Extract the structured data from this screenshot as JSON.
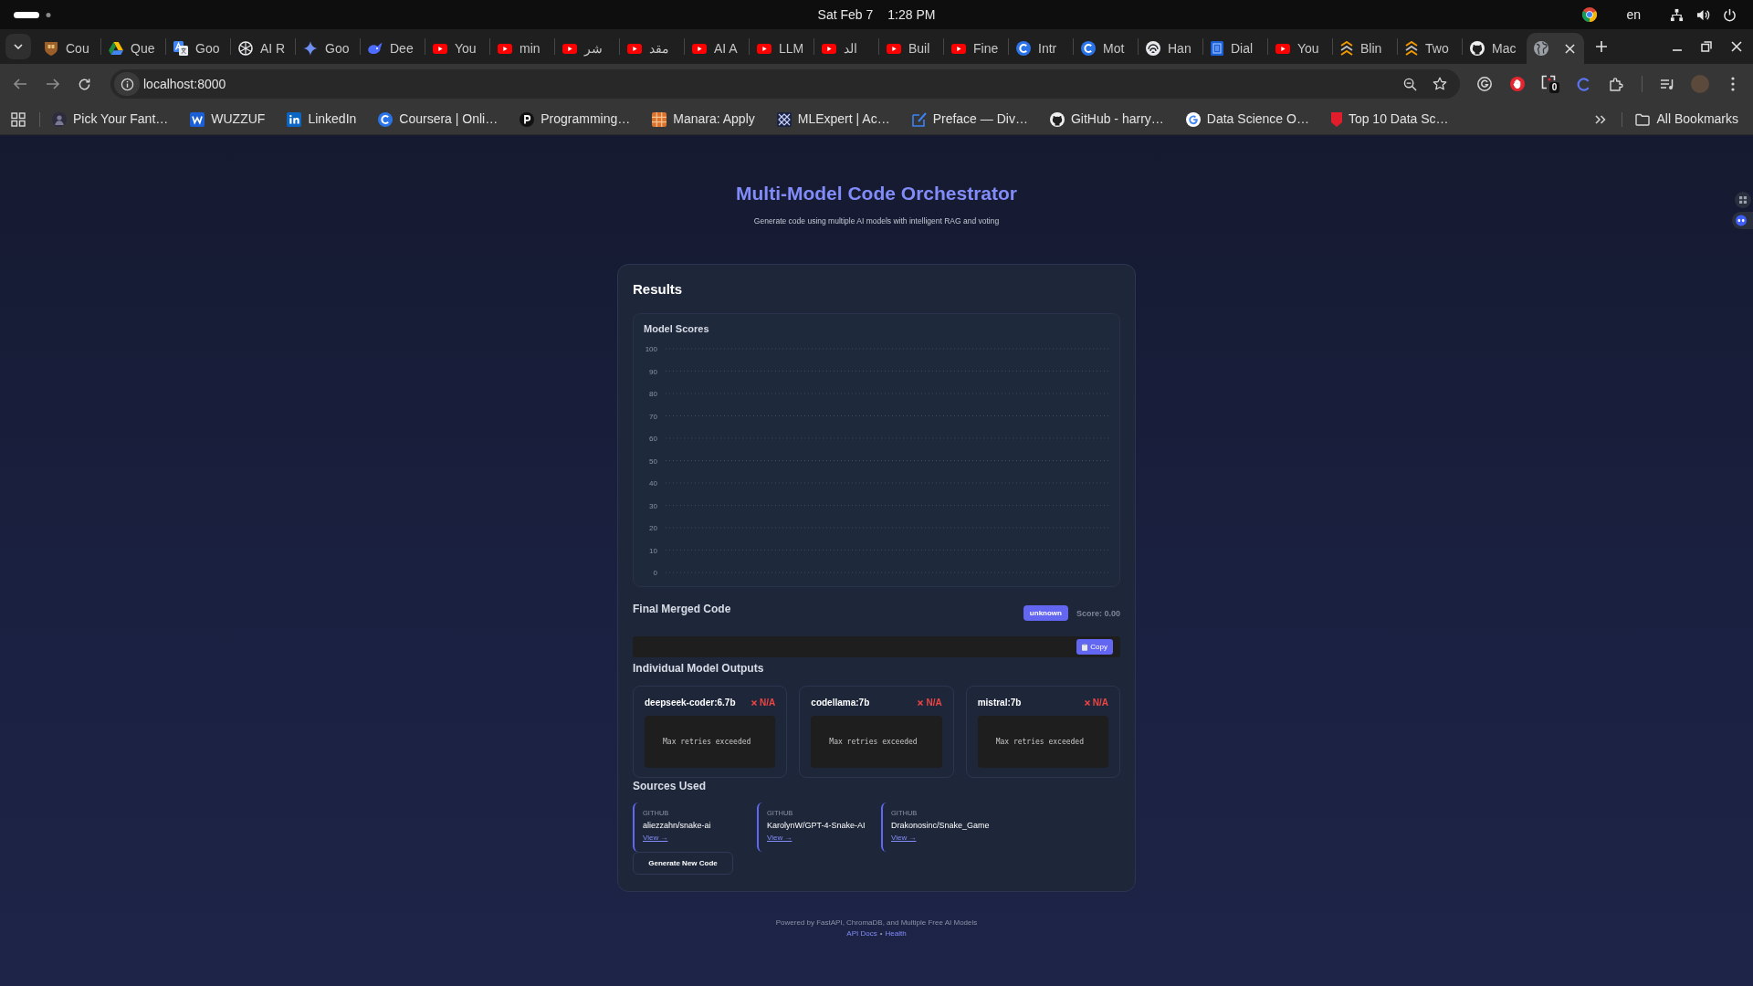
{
  "system_bar": {
    "date": "Sat Feb 7",
    "time": "1:28 PM",
    "input_language": "en"
  },
  "browser": {
    "tabs": [
      {
        "kind": "crest",
        "title": "Cou",
        "selected": false
      },
      {
        "kind": "triangle",
        "title": "Que",
        "selected": false
      },
      {
        "kind": "translate",
        "title": "Goo",
        "selected": false
      },
      {
        "kind": "wheel",
        "title": "AI R",
        "selected": false
      },
      {
        "kind": "sparkle",
        "title": "Goo",
        "selected": false
      },
      {
        "kind": "whale",
        "title": "Dee",
        "selected": false
      },
      {
        "kind": "play",
        "title": "You",
        "selected": false
      },
      {
        "kind": "play",
        "title": "min",
        "selected": false
      },
      {
        "kind": "play",
        "title": "شر",
        "selected": false
      },
      {
        "kind": "play",
        "title": "مقد",
        "selected": false
      },
      {
        "kind": "play",
        "title": "AI A",
        "selected": false
      },
      {
        "kind": "play",
        "title": "LLM",
        "selected": false
      },
      {
        "kind": "play",
        "title": "الد",
        "selected": false
      },
      {
        "kind": "play",
        "title": "Buil",
        "selected": false
      },
      {
        "kind": "play",
        "title": "Fine",
        "selected": false
      },
      {
        "kind": "cee",
        "title": "Intr",
        "selected": false
      },
      {
        "kind": "cee",
        "title": "Mot",
        "selected": false
      },
      {
        "kind": "arcs",
        "title": "Han",
        "selected": false
      },
      {
        "kind": "document",
        "title": "Dial",
        "selected": false
      },
      {
        "kind": "play",
        "title": "You",
        "selected": false
      },
      {
        "kind": "chevrons",
        "title": "Blin",
        "selected": false
      },
      {
        "kind": "chevrons",
        "title": "Two",
        "selected": false
      },
      {
        "kind": "cat",
        "title": "Mac",
        "selected": false
      },
      {
        "kind": "globe",
        "selected": true
      }
    ],
    "address": "localhost:8000",
    "extension_badge": "0",
    "bookmarks": [
      {
        "kind": "figure",
        "label": "Pick Your Fant…"
      },
      {
        "kind": "w",
        "label": "WUZZUF"
      },
      {
        "kind": "in",
        "label": "LinkedIn"
      },
      {
        "kind": "cee",
        "label": "Coursera | Onli…"
      },
      {
        "kind": "pee",
        "label": "Programming…"
      },
      {
        "kind": "pattern",
        "label": "Manara: Apply"
      },
      {
        "kind": "lattice",
        "label": "MLExpert | Ac…"
      },
      {
        "kind": "notepad",
        "label": "Preface — Div…"
      },
      {
        "kind": "cat",
        "label": "GitHub - harry…"
      },
      {
        "kind": "gee",
        "label": "Data Science O…"
      },
      {
        "kind": "shield",
        "label": "Top 10 Data Sc…"
      }
    ],
    "all_bookmarks": "All Bookmarks"
  },
  "page": {
    "title": "Multi-Model Code Orchestrator",
    "subtitle": "Generate code using multiple AI models with intelligent RAG and voting",
    "results": {
      "heading": "Results",
      "scores_chart": {
        "title": "Model Scores",
        "y_axis_labels": [
          "100",
          "90",
          "80",
          "70",
          "60",
          "50",
          "40",
          "30",
          "20",
          "10",
          "0"
        ]
      },
      "final_code": {
        "heading": "Final Merged Code",
        "badge": "unknown",
        "score": "Score: 0.00",
        "copy_button": "Copy"
      },
      "model_outputs": {
        "heading": "Individual Model Outputs",
        "models": [
          {
            "name": "deepseek-coder:6.7b",
            "failed": true,
            "score": "N/A",
            "output": "Max retries exceeded"
          },
          {
            "name": "codellama:7b",
            "failed": true,
            "score": "N/A",
            "output": "Max retries exceeded"
          },
          {
            "name": "mistral:7b",
            "failed": true,
            "score": "N/A",
            "output": "Max retries exceeded"
          }
        ]
      },
      "sources": {
        "heading": "Sources Used",
        "items": [
          {
            "source": "GITHUB",
            "name": "aliezzahn/snake-ai",
            "link": "View →"
          },
          {
            "source": "GITHUB",
            "name": "KarolynW/GPT-4-Snake-AI",
            "link": "View →"
          },
          {
            "source": "GITHUB",
            "name": "Drakonosinc/Snake_Game",
            "link": "View →"
          }
        ]
      },
      "generate_button": "Generate New Code"
    },
    "footer": {
      "text": "Powered by FastAPI, ChromaDB, and Multiple Free AI Models",
      "links": [
        "API Docs",
        "Health"
      ],
      "separator": "•"
    }
  }
}
